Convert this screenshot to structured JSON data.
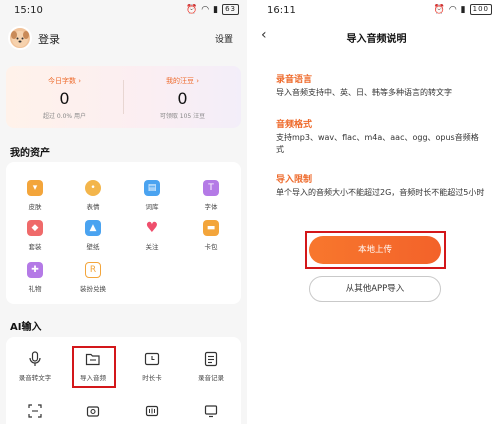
{
  "left": {
    "status": {
      "time": "15:10",
      "battery": "63"
    },
    "header": {
      "login": "登录",
      "settings": "设置"
    },
    "stats": [
      {
        "title": "今日字数 ›",
        "value": "0",
        "sub": "超过 0.0% 用户"
      },
      {
        "title": "我的汪豆 ›",
        "value": "0",
        "sub": "可领取 105 汪豆"
      }
    ],
    "assets": {
      "title": "我的资产",
      "items": [
        {
          "label": "皮肤",
          "icon": "shirt-icon",
          "color": "#f3a53b"
        },
        {
          "label": "表情",
          "icon": "emoji-icon",
          "color": "#f3a53b"
        },
        {
          "label": "词库",
          "icon": "book-icon",
          "color": "#4aa3f0"
        },
        {
          "label": "字体",
          "icon": "font-icon",
          "color": "#b47ae6"
        },
        {
          "label": "套装",
          "icon": "suit-icon",
          "color": "#ef6a6a"
        },
        {
          "label": "壁纸",
          "icon": "wallpaper-icon",
          "color": "#4aa3f0"
        },
        {
          "label": "关注",
          "icon": "heart-icon",
          "color": "#ef4f6d"
        },
        {
          "label": "卡包",
          "icon": "card-icon",
          "color": "#f3a53b"
        },
        {
          "label": "礼物",
          "icon": "gift-icon",
          "color": "#b47ae6"
        },
        {
          "label": "装扮兑换",
          "icon": "exchange-icon",
          "color": "#f3a53b"
        }
      ]
    },
    "ai": {
      "title": "AI输入",
      "items": [
        {
          "label": "录音转文字",
          "icon": "mic-icon"
        },
        {
          "label": "导入音频",
          "icon": "folder-icon"
        },
        {
          "label": "时长卡",
          "icon": "clock-card-icon"
        },
        {
          "label": "录音记录",
          "icon": "record-list-icon"
        },
        {
          "label": "",
          "icon": "scan-icon"
        },
        {
          "label": "",
          "icon": "camera-icon"
        },
        {
          "label": "",
          "icon": "video-icon"
        },
        {
          "label": "",
          "icon": "screen-icon"
        }
      ]
    }
  },
  "right": {
    "status": {
      "time": "16:11",
      "battery": "100"
    },
    "title": "导入音频说明",
    "sections": [
      {
        "heading": "录音语言",
        "body": "导入音频支持中、英、日、韩等多种语言的转文字"
      },
      {
        "heading": "音频格式",
        "body": "支持mp3、wav、flac、m4a、aac、ogg、opus音频格式"
      },
      {
        "heading": "导入限制",
        "body": "单个导入的音频大小不能超过2G，音频时长不能超过5小时"
      }
    ],
    "upload_label": "本地上传",
    "other_app_label": "从其他APP导入"
  }
}
